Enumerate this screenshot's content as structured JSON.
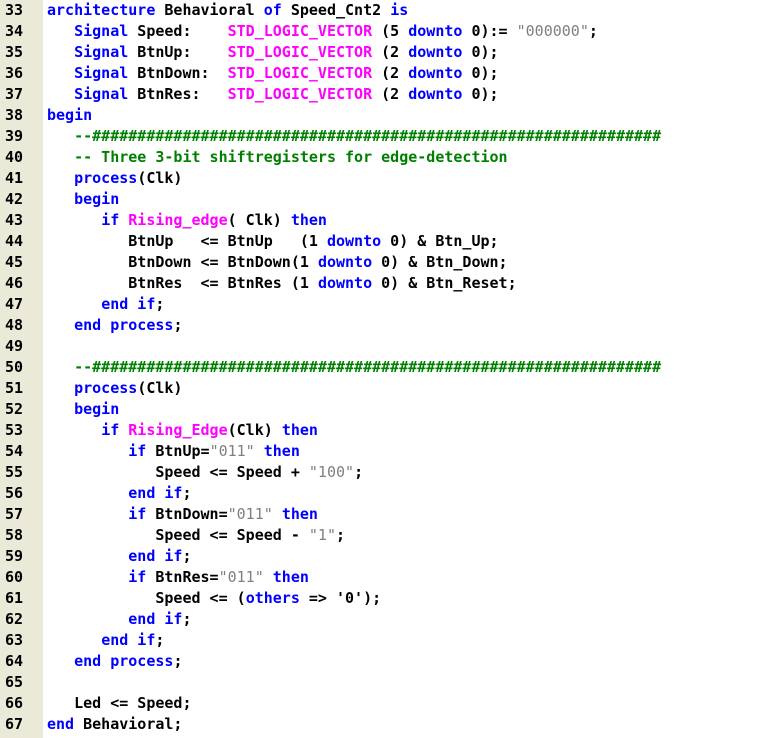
{
  "colors": {
    "keyword": "#0000ff",
    "comment": "#008000",
    "string": "#808080",
    "type": "#ff00ff",
    "plain": "#000000",
    "gutter": "#ebe9d7",
    "background": "#ffffff"
  },
  "lines": [
    {
      "n": "33",
      "tokens": [
        {
          "t": "kw",
          "v": "architecture"
        },
        {
          "t": "pl",
          "v": " Behavioral "
        },
        {
          "t": "kw",
          "v": "of"
        },
        {
          "t": "pl",
          "v": " Speed_Cnt2 "
        },
        {
          "t": "kw",
          "v": "is"
        }
      ]
    },
    {
      "n": "34",
      "tokens": [
        {
          "t": "pl",
          "v": "   "
        },
        {
          "t": "kw",
          "v": "Signal"
        },
        {
          "t": "pl",
          "v": " Speed:    "
        },
        {
          "t": "ty",
          "v": "STD_LOGIC_VECTOR"
        },
        {
          "t": "pl",
          "v": " (5 "
        },
        {
          "t": "kw",
          "v": "downto"
        },
        {
          "t": "pl",
          "v": " 0):= "
        },
        {
          "t": "st",
          "v": "\"000000\""
        },
        {
          "t": "pl",
          "v": ";"
        }
      ]
    },
    {
      "n": "35",
      "tokens": [
        {
          "t": "pl",
          "v": "   "
        },
        {
          "t": "kw",
          "v": "Signal"
        },
        {
          "t": "pl",
          "v": " BtnUp:    "
        },
        {
          "t": "ty",
          "v": "STD_LOGIC_VECTOR"
        },
        {
          "t": "pl",
          "v": " (2 "
        },
        {
          "t": "kw",
          "v": "downto"
        },
        {
          "t": "pl",
          "v": " 0);"
        }
      ]
    },
    {
      "n": "36",
      "tokens": [
        {
          "t": "pl",
          "v": "   "
        },
        {
          "t": "kw",
          "v": "Signal"
        },
        {
          "t": "pl",
          "v": " BtnDown:  "
        },
        {
          "t": "ty",
          "v": "STD_LOGIC_VECTOR"
        },
        {
          "t": "pl",
          "v": " (2 "
        },
        {
          "t": "kw",
          "v": "downto"
        },
        {
          "t": "pl",
          "v": " 0);"
        }
      ]
    },
    {
      "n": "37",
      "tokens": [
        {
          "t": "pl",
          "v": "   "
        },
        {
          "t": "kw",
          "v": "Signal"
        },
        {
          "t": "pl",
          "v": " BtnRes:   "
        },
        {
          "t": "ty",
          "v": "STD_LOGIC_VECTOR"
        },
        {
          "t": "pl",
          "v": " (2 "
        },
        {
          "t": "kw",
          "v": "downto"
        },
        {
          "t": "pl",
          "v": " 0);"
        }
      ]
    },
    {
      "n": "38",
      "tokens": [
        {
          "t": "kw",
          "v": "begin"
        }
      ]
    },
    {
      "n": "39",
      "tokens": [
        {
          "t": "pl",
          "v": "   "
        },
        {
          "t": "cm",
          "v": "--###############################################################"
        }
      ]
    },
    {
      "n": "40",
      "tokens": [
        {
          "t": "pl",
          "v": "   "
        },
        {
          "t": "cm",
          "v": "-- Three 3-bit shiftregisters for edge-detection"
        }
      ]
    },
    {
      "n": "41",
      "tokens": [
        {
          "t": "pl",
          "v": "   "
        },
        {
          "t": "kw",
          "v": "process"
        },
        {
          "t": "pl",
          "v": "(Clk)"
        }
      ]
    },
    {
      "n": "42",
      "tokens": [
        {
          "t": "pl",
          "v": "   "
        },
        {
          "t": "kw",
          "v": "begin"
        }
      ]
    },
    {
      "n": "43",
      "tokens": [
        {
          "t": "pl",
          "v": "      "
        },
        {
          "t": "kw",
          "v": "if"
        },
        {
          "t": "pl",
          "v": " "
        },
        {
          "t": "fn",
          "v": "Rising_edge"
        },
        {
          "t": "pl",
          "v": "( Clk) "
        },
        {
          "t": "kw",
          "v": "then"
        }
      ]
    },
    {
      "n": "44",
      "tokens": [
        {
          "t": "pl",
          "v": "         BtnUp   <= BtnUp   (1 "
        },
        {
          "t": "kw",
          "v": "downto"
        },
        {
          "t": "pl",
          "v": " 0) & Btn_Up;"
        }
      ]
    },
    {
      "n": "45",
      "tokens": [
        {
          "t": "pl",
          "v": "         BtnDown <= BtnDown(1 "
        },
        {
          "t": "kw",
          "v": "downto"
        },
        {
          "t": "pl",
          "v": " 0) & Btn_Down;"
        }
      ]
    },
    {
      "n": "46",
      "tokens": [
        {
          "t": "pl",
          "v": "         BtnRes  <= BtnRes (1 "
        },
        {
          "t": "kw",
          "v": "downto"
        },
        {
          "t": "pl",
          "v": " 0) & Btn_Reset;"
        }
      ]
    },
    {
      "n": "47",
      "tokens": [
        {
          "t": "pl",
          "v": "      "
        },
        {
          "t": "kw",
          "v": "end if"
        },
        {
          "t": "pl",
          "v": ";"
        }
      ]
    },
    {
      "n": "48",
      "tokens": [
        {
          "t": "pl",
          "v": "   "
        },
        {
          "t": "kw",
          "v": "end process"
        },
        {
          "t": "pl",
          "v": ";"
        }
      ]
    },
    {
      "n": "49",
      "tokens": []
    },
    {
      "n": "50",
      "tokens": [
        {
          "t": "pl",
          "v": "   "
        },
        {
          "t": "cm",
          "v": "--###############################################################"
        }
      ]
    },
    {
      "n": "51",
      "tokens": [
        {
          "t": "pl",
          "v": "   "
        },
        {
          "t": "kw",
          "v": "process"
        },
        {
          "t": "pl",
          "v": "(Clk)"
        }
      ]
    },
    {
      "n": "52",
      "tokens": [
        {
          "t": "pl",
          "v": "   "
        },
        {
          "t": "kw",
          "v": "begin"
        }
      ]
    },
    {
      "n": "53",
      "tokens": [
        {
          "t": "pl",
          "v": "      "
        },
        {
          "t": "kw",
          "v": "if"
        },
        {
          "t": "pl",
          "v": " "
        },
        {
          "t": "fn",
          "v": "Rising_Edge"
        },
        {
          "t": "pl",
          "v": "(Clk) "
        },
        {
          "t": "kw",
          "v": "then"
        }
      ]
    },
    {
      "n": "54",
      "tokens": [
        {
          "t": "pl",
          "v": "         "
        },
        {
          "t": "kw",
          "v": "if"
        },
        {
          "t": "pl",
          "v": " BtnUp="
        },
        {
          "t": "st",
          "v": "\"011\""
        },
        {
          "t": "pl",
          "v": " "
        },
        {
          "t": "kw",
          "v": "then"
        }
      ]
    },
    {
      "n": "55",
      "tokens": [
        {
          "t": "pl",
          "v": "            Speed <= Speed + "
        },
        {
          "t": "st",
          "v": "\"100\""
        },
        {
          "t": "pl",
          "v": ";"
        }
      ]
    },
    {
      "n": "56",
      "tokens": [
        {
          "t": "pl",
          "v": "         "
        },
        {
          "t": "kw",
          "v": "end if"
        },
        {
          "t": "pl",
          "v": ";"
        }
      ]
    },
    {
      "n": "57",
      "tokens": [
        {
          "t": "pl",
          "v": "         "
        },
        {
          "t": "kw",
          "v": "if"
        },
        {
          "t": "pl",
          "v": " BtnDown="
        },
        {
          "t": "st",
          "v": "\"011\""
        },
        {
          "t": "pl",
          "v": " "
        },
        {
          "t": "kw",
          "v": "then"
        }
      ]
    },
    {
      "n": "58",
      "tokens": [
        {
          "t": "pl",
          "v": "            Speed <= Speed - "
        },
        {
          "t": "st",
          "v": "\"1\""
        },
        {
          "t": "pl",
          "v": ";"
        }
      ]
    },
    {
      "n": "59",
      "tokens": [
        {
          "t": "pl",
          "v": "         "
        },
        {
          "t": "kw",
          "v": "end if"
        },
        {
          "t": "pl",
          "v": ";"
        }
      ]
    },
    {
      "n": "60",
      "tokens": [
        {
          "t": "pl",
          "v": "         "
        },
        {
          "t": "kw",
          "v": "if"
        },
        {
          "t": "pl",
          "v": " BtnRes="
        },
        {
          "t": "st",
          "v": "\"011\""
        },
        {
          "t": "pl",
          "v": " "
        },
        {
          "t": "kw",
          "v": "then"
        }
      ]
    },
    {
      "n": "61",
      "tokens": [
        {
          "t": "pl",
          "v": "            Speed <= ("
        },
        {
          "t": "kw",
          "v": "others"
        },
        {
          "t": "pl",
          "v": " => '0');"
        }
      ]
    },
    {
      "n": "62",
      "tokens": [
        {
          "t": "pl",
          "v": "         "
        },
        {
          "t": "kw",
          "v": "end if"
        },
        {
          "t": "pl",
          "v": ";"
        }
      ]
    },
    {
      "n": "63",
      "tokens": [
        {
          "t": "pl",
          "v": "      "
        },
        {
          "t": "kw",
          "v": "end if"
        },
        {
          "t": "pl",
          "v": ";"
        }
      ]
    },
    {
      "n": "64",
      "tokens": [
        {
          "t": "pl",
          "v": "   "
        },
        {
          "t": "kw",
          "v": "end process"
        },
        {
          "t": "pl",
          "v": ";"
        }
      ]
    },
    {
      "n": "65",
      "tokens": []
    },
    {
      "n": "66",
      "tokens": [
        {
          "t": "pl",
          "v": "   Led <= Speed;"
        }
      ]
    },
    {
      "n": "67",
      "tokens": [
        {
          "t": "kw",
          "v": "end"
        },
        {
          "t": "pl",
          "v": " Behavioral;"
        }
      ]
    }
  ]
}
